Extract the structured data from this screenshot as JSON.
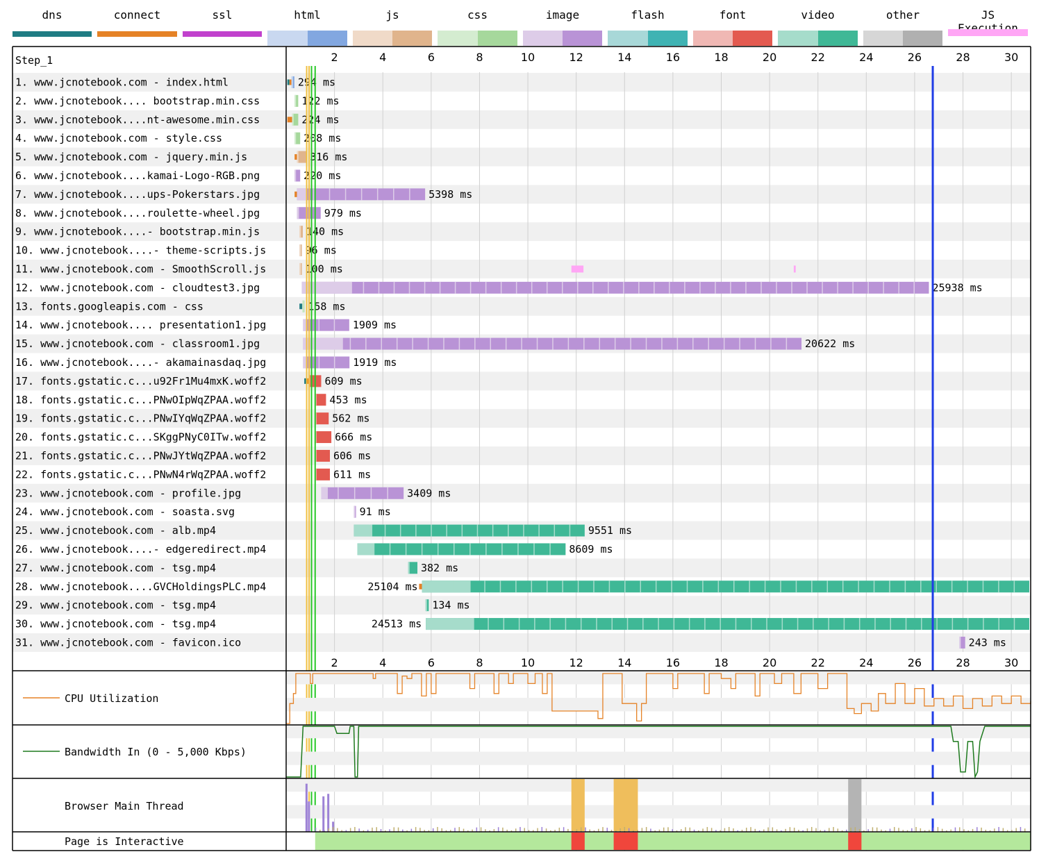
{
  "legend": [
    {
      "name": "dns",
      "colors": [
        "#1f7c83"
      ]
    },
    {
      "name": "connect",
      "colors": [
        "#e58226"
      ]
    },
    {
      "name": "ssl",
      "colors": [
        "#c141cd"
      ]
    },
    {
      "name": "html",
      "colors": [
        "#c9d8f0",
        "#82a7e0"
      ]
    },
    {
      "name": "js",
      "colors": [
        "#f0dac8",
        "#e0b48c"
      ]
    },
    {
      "name": "css",
      "colors": [
        "#d4ecd0",
        "#a6d89c"
      ]
    },
    {
      "name": "image",
      "colors": [
        "#ddcce8",
        "#b993d6"
      ]
    },
    {
      "name": "flash",
      "colors": [
        "#a8d8d8",
        "#3fb3b3"
      ]
    },
    {
      "name": "font",
      "colors": [
        "#f0b8b4",
        "#e35a50"
      ]
    },
    {
      "name": "video",
      "colors": [
        "#a6dccb",
        "#3fb896"
      ]
    },
    {
      "name": "other",
      "colors": [
        "#d6d6d6",
        "#b0b0b0"
      ]
    },
    {
      "name": "JS Execution",
      "colors": [
        "#ffa6f5"
      ]
    }
  ],
  "step_label": "Step_1",
  "chart_data": {
    "type": "waterfall",
    "x_unit": "seconds",
    "xlim": [
      0,
      30.8
    ],
    "x_ticks": [
      2,
      4,
      6,
      8,
      10,
      12,
      14,
      16,
      18,
      20,
      22,
      24,
      26,
      28,
      30
    ],
    "vertical_markers": [
      {
        "name": "start render",
        "x": 0.85,
        "color": "#f0c040"
      },
      {
        "name": "dom content loaded",
        "x": 0.95,
        "color": "#f0c040"
      },
      {
        "name": "onload-1",
        "x": 1.05,
        "color": "#28c828"
      },
      {
        "name": "onload-2",
        "x": 1.2,
        "color": "#28c828"
      },
      {
        "name": "document complete",
        "x": 26.75,
        "color": "#1f3ce6"
      }
    ],
    "requests": [
      {
        "label": "1. www.jcnotebook.com - index.html",
        "type": "html",
        "start": 0.05,
        "end": 0.34,
        "duration": "294 ms",
        "dns": 0.08,
        "connect": 0.08
      },
      {
        "label": "2. www.jcnotebook.... bootstrap.min.css",
        "type": "css",
        "start": 0.35,
        "end": 0.5,
        "duration": "122 ms"
      },
      {
        "label": "3. www.jcnotebook....nt-awesome.min.css",
        "type": "css",
        "start": 0.05,
        "end": 0.5,
        "duration": "224 ms",
        "connect": 0.2
      },
      {
        "label": "4. www.jcnotebook.com - style.css",
        "type": "css",
        "start": 0.35,
        "end": 0.58,
        "duration": "208 ms"
      },
      {
        "label": "5. www.jcnotebook.com - jquery.min.js",
        "type": "js",
        "start": 0.35,
        "end": 0.84,
        "duration": "316 ms",
        "connect": 0.1
      },
      {
        "label": "6. www.jcnotebook....kamai-Logo-RGB.png",
        "type": "image",
        "start": 0.35,
        "end": 0.58,
        "duration": "220 ms"
      },
      {
        "label": "7. www.jcnotebook....ups-Pokerstars.jpg",
        "type": "image",
        "start": 0.35,
        "end": 5.75,
        "duration": "5398 ms",
        "connect": 0.1
      },
      {
        "label": "8. www.jcnotebook....roulette-wheel.jpg",
        "type": "image",
        "start": 0.45,
        "end": 1.43,
        "duration": "979 ms"
      },
      {
        "label": "9. www.jcnotebook....- bootstrap.min.js",
        "type": "js",
        "start": 0.55,
        "end": 0.69,
        "duration": "140 ms"
      },
      {
        "label": "10. www.jcnotebook....- theme-scripts.js",
        "type": "js",
        "start": 0.55,
        "end": 0.65,
        "duration": "96 ms"
      },
      {
        "label": "11. www.jcnotebook.com - SmoothScroll.js",
        "type": "js",
        "start": 0.55,
        "end": 0.65,
        "duration": "100 ms"
      },
      {
        "label": "12. www.jcnotebook.com - cloudtest3.jpg",
        "type": "image",
        "start": 0.65,
        "end": 26.59,
        "duration": "25938 ms"
      },
      {
        "label": "13. fonts.googleapis.com - css",
        "type": "css",
        "start": 0.55,
        "end": 0.71,
        "duration": "158 ms",
        "dns": 0.12
      },
      {
        "label": "14. www.jcnotebook.... presentation1.jpg",
        "type": "image",
        "start": 0.7,
        "end": 2.61,
        "duration": "1909 ms"
      },
      {
        "label": "15. www.jcnotebook.com - classroom1.jpg",
        "type": "image",
        "start": 0.7,
        "end": 21.32,
        "duration": "20622 ms"
      },
      {
        "label": "16. www.jcnotebook....- akamainasdaq.jpg",
        "type": "image",
        "start": 0.7,
        "end": 2.62,
        "duration": "1919 ms"
      },
      {
        "label": "17. fonts.gstatic.c...u92Fr1Mu4mxK.woff2",
        "type": "font",
        "start": 0.75,
        "end": 1.45,
        "duration": "609 ms",
        "dns": 0.08,
        "connect": 0.1
      },
      {
        "label": "18. fonts.gstatic.c...PNwOIpWqZPAA.woff2",
        "type": "font",
        "start": 1.2,
        "end": 1.65,
        "duration": "453 ms"
      },
      {
        "label": "19. fonts.gstatic.c...PNwIYqWqZPAA.woff2",
        "type": "font",
        "start": 1.2,
        "end": 1.76,
        "duration": "562 ms"
      },
      {
        "label": "20. fonts.gstatic.c...SKggPNyC0ITw.woff2",
        "type": "font",
        "start": 1.2,
        "end": 1.87,
        "duration": "666 ms"
      },
      {
        "label": "21. fonts.gstatic.c...PNwJYtWqZPAA.woff2",
        "type": "font",
        "start": 1.2,
        "end": 1.81,
        "duration": "606 ms"
      },
      {
        "label": "22. fonts.gstatic.c...PNwN4rWqZPAA.woff2",
        "type": "font",
        "start": 1.2,
        "end": 1.81,
        "duration": "611 ms"
      },
      {
        "label": "23. www.jcnotebook.com - profile.jpg",
        "type": "image",
        "start": 1.45,
        "end": 4.86,
        "duration": "3409 ms"
      },
      {
        "label": "24. www.jcnotebook.com - soasta.svg",
        "type": "image",
        "start": 2.8,
        "end": 2.89,
        "duration": "91 ms"
      },
      {
        "label": "25. www.jcnotebook.com - alb.mp4",
        "type": "video",
        "start": 2.8,
        "end": 12.35,
        "duration": "9551 ms"
      },
      {
        "label": "26. www.jcnotebook....- edgeredirect.mp4",
        "type": "video",
        "start": 2.95,
        "end": 11.56,
        "duration": "8609 ms"
      },
      {
        "label": "27. www.jcnotebook.com - tsg.mp4",
        "type": "video",
        "start": 5.05,
        "end": 5.43,
        "duration": "382 ms"
      },
      {
        "label": "28. www.jcnotebook....GVCHoldingsPLC.mp4",
        "type": "video",
        "start": 5.5,
        "end": 30.8,
        "duration": "25104 ms",
        "label_left": true,
        "connect": 0.12
      },
      {
        "label": "29. www.jcnotebook.com - tsg.mp4",
        "type": "video",
        "start": 5.77,
        "end": 5.9,
        "duration": "134 ms"
      },
      {
        "label": "30. www.jcnotebook.com - tsg.mp4",
        "type": "video",
        "start": 5.78,
        "end": 30.8,
        "duration": "24513 ms",
        "label_left": true
      },
      {
        "label": "31. www.jcnotebook.com - favicon.ico",
        "type": "image",
        "start": 27.85,
        "end": 28.09,
        "duration": "243 ms"
      }
    ],
    "js_execution": [
      {
        "row": 11,
        "start": 11.8,
        "end": 12.3
      },
      {
        "row": 11,
        "start": 21.0,
        "end": 21.08
      }
    ],
    "cpu_utilization": {
      "label": "CPU Utilization",
      "ylim": [
        0,
        100
      ],
      "points": [
        [
          0,
          0
        ],
        [
          0.15,
          40
        ],
        [
          0.3,
          60
        ],
        [
          0.4,
          100
        ],
        [
          0.9,
          100
        ],
        [
          1.0,
          80
        ],
        [
          1.1,
          100
        ],
        [
          3.5,
          100
        ],
        [
          3.6,
          90
        ],
        [
          3.7,
          100
        ],
        [
          4.5,
          100
        ],
        [
          4.6,
          60
        ],
        [
          4.8,
          95
        ],
        [
          5.0,
          90
        ],
        [
          5.2,
          100
        ],
        [
          5.6,
          55
        ],
        [
          5.8,
          100
        ],
        [
          6.0,
          60
        ],
        [
          6.2,
          100
        ],
        [
          7.5,
          100
        ],
        [
          7.6,
          70
        ],
        [
          7.8,
          100
        ],
        [
          8.5,
          100
        ],
        [
          8.6,
          60
        ],
        [
          8.8,
          100
        ],
        [
          9.2,
          80
        ],
        [
          9.4,
          100
        ],
        [
          10.0,
          80
        ],
        [
          10.3,
          100
        ],
        [
          10.6,
          60
        ],
        [
          10.8,
          100
        ],
        [
          11.0,
          25
        ],
        [
          12.8,
          25
        ],
        [
          12.9,
          10
        ],
        [
          13.1,
          100
        ],
        [
          13.8,
          100
        ],
        [
          13.9,
          40
        ],
        [
          14.3,
          40
        ],
        [
          14.5,
          5
        ],
        [
          14.7,
          40
        ],
        [
          14.9,
          100
        ],
        [
          15.8,
          100
        ],
        [
          16.0,
          70
        ],
        [
          16.2,
          100
        ],
        [
          17.2,
          100
        ],
        [
          17.3,
          60
        ],
        [
          17.5,
          100
        ],
        [
          18.0,
          90
        ],
        [
          18.4,
          70
        ],
        [
          18.6,
          100
        ],
        [
          19.2,
          100
        ],
        [
          19.4,
          55
        ],
        [
          19.6,
          100
        ],
        [
          20.2,
          80
        ],
        [
          20.5,
          100
        ],
        [
          21.0,
          60
        ],
        [
          21.3,
          100
        ],
        [
          22.0,
          70
        ],
        [
          22.4,
          100
        ],
        [
          23.0,
          100
        ],
        [
          23.2,
          30
        ],
        [
          23.5,
          20
        ],
        [
          23.8,
          40
        ],
        [
          24.2,
          25
        ],
        [
          24.5,
          60
        ],
        [
          24.8,
          40
        ],
        [
          25.2,
          80
        ],
        [
          25.6,
          40
        ],
        [
          26.0,
          70
        ],
        [
          26.4,
          35
        ],
        [
          26.8,
          50
        ],
        [
          27.2,
          35
        ],
        [
          27.6,
          55
        ],
        [
          28.0,
          30
        ],
        [
          28.4,
          50
        ],
        [
          28.8,
          35
        ],
        [
          29.2,
          55
        ],
        [
          29.6,
          40
        ],
        [
          30.0,
          55
        ],
        [
          30.4,
          40
        ],
        [
          30.8,
          45
        ]
      ]
    },
    "bandwidth_in": {
      "label": "Bandwidth In (0 - 5,000 Kbps)",
      "ylim": [
        0,
        5000
      ],
      "points": [
        [
          0,
          0
        ],
        [
          0.6,
          0
        ],
        [
          0.7,
          5000
        ],
        [
          2.0,
          5000
        ],
        [
          2.1,
          4300
        ],
        [
          2.6,
          4300
        ],
        [
          2.65,
          5000
        ],
        [
          2.8,
          5000
        ],
        [
          2.85,
          0
        ],
        [
          2.95,
          0
        ],
        [
          3.0,
          5000
        ],
        [
          27.5,
          5000
        ],
        [
          27.6,
          3500
        ],
        [
          27.8,
          3500
        ],
        [
          27.9,
          500
        ],
        [
          28.1,
          500
        ],
        [
          28.2,
          3500
        ],
        [
          28.4,
          3500
        ],
        [
          28.5,
          0
        ],
        [
          28.6,
          500
        ],
        [
          28.7,
          3500
        ],
        [
          28.9,
          5000
        ],
        [
          30.8,
          5000
        ]
      ]
    },
    "main_thread": {
      "label": "Browser Main Thread",
      "blocks": [
        {
          "start": 11.8,
          "end": 12.35,
          "color": "#efbe5c"
        },
        {
          "start": 13.55,
          "end": 14.55,
          "color": "#efbe5c"
        },
        {
          "start": 23.25,
          "end": 23.8,
          "color": "#b4b4b4"
        }
      ],
      "spikes": [
        {
          "x": 0.8,
          "h": 0.95,
          "color": "#9d82d6"
        },
        {
          "x": 0.9,
          "h": 0.6,
          "color": "#9d82d6"
        },
        {
          "x": 1.5,
          "h": 0.7,
          "color": "#9d82d6"
        },
        {
          "x": 1.7,
          "h": 0.75,
          "color": "#9d82d6"
        },
        {
          "x": 1.9,
          "h": 0.2,
          "color": "#9d82d6"
        }
      ]
    },
    "interactive": {
      "label": "Page is Interactive",
      "start": 1.2,
      "end": 30.8,
      "blocks": [
        {
          "start": 11.8,
          "end": 12.35
        },
        {
          "start": 13.55,
          "end": 14.55
        },
        {
          "start": 23.25,
          "end": 23.8
        }
      ]
    }
  }
}
